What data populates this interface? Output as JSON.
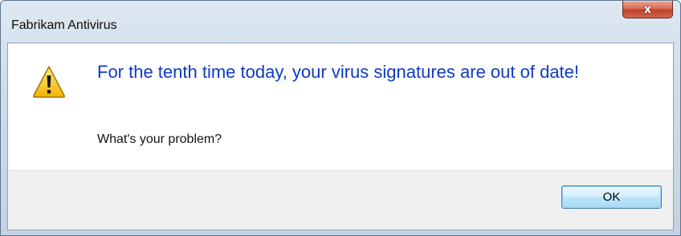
{
  "window": {
    "title": "Fabrikam Antivirus",
    "close_glyph": "x"
  },
  "dialog": {
    "icon": "warning-icon",
    "main_instruction": "For the tenth time today, your virus signatures are out of date!",
    "content": "What's your problem?",
    "ok_label": "OK"
  },
  "colors": {
    "main_instruction": "#0f3ac2",
    "close_button": "#c0412a",
    "footer": "#f0f0f0"
  }
}
